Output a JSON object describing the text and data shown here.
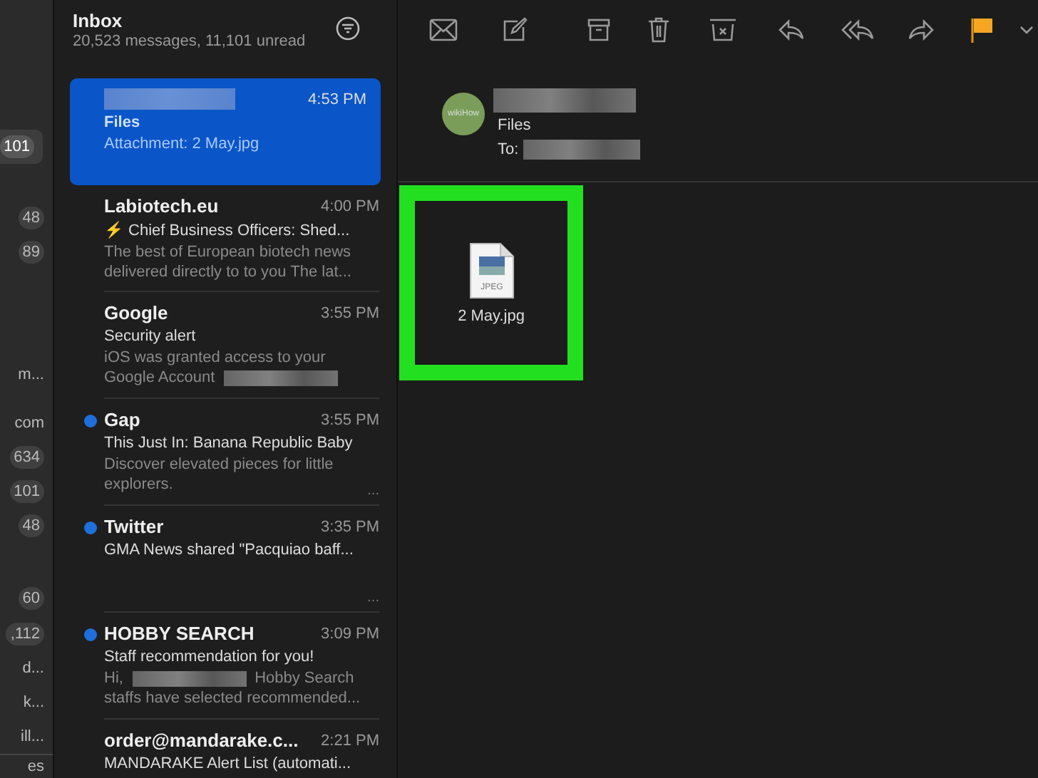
{
  "sidebar": {
    "items": [
      {
        "kind": "badge",
        "text": "101",
        "selected": true
      },
      {
        "kind": "badge",
        "text": "48",
        "selected": false
      },
      {
        "kind": "badge",
        "text": "89",
        "selected": false
      },
      {
        "kind": "label",
        "text": "m...",
        "selected": false
      },
      {
        "kind": "label",
        "text": "com",
        "selected": false
      },
      {
        "kind": "badge",
        "text": "634",
        "selected": false
      },
      {
        "kind": "badge",
        "text": "101",
        "selected": false
      },
      {
        "kind": "badge",
        "text": "48",
        "selected": false
      },
      {
        "kind": "badge",
        "text": "60",
        "selected": false
      },
      {
        "kind": "badge",
        "text": ",112",
        "selected": false
      },
      {
        "kind": "label",
        "text": "d...",
        "selected": false
      },
      {
        "kind": "label",
        "text": "k...",
        "selected": false
      },
      {
        "kind": "label",
        "text": "ill...",
        "selected": false
      },
      {
        "kind": "footer",
        "text": "es",
        "selected": false
      }
    ]
  },
  "mailbox": {
    "title": "Inbox",
    "subtitle": "20,523 messages, 11,101 unread"
  },
  "messages": [
    {
      "time": "4:53 PM",
      "subject": "Files",
      "preview": [
        {
          "kind": "text",
          "text": "Attachment: 2 May.jpg"
        }
      ],
      "selected": true,
      "unread": false
    },
    {
      "sender": "Labiotech.eu",
      "time": "4:00 PM",
      "subject": "⚡ Chief Business Officers: Shed...",
      "preview": [
        {
          "kind": "text",
          "text": "The best of European biotech news delivered directly to to you The lat..."
        }
      ],
      "selected": false,
      "unread": false
    },
    {
      "sender": "Google",
      "time": "3:55 PM",
      "subject": "Security alert",
      "preview": [
        {
          "kind": "text",
          "text": "iOS was granted access to your"
        },
        {
          "kind": "text",
          "text": "Google Account"
        },
        {
          "kind": "redacted"
        }
      ],
      "selected": false,
      "unread": false
    },
    {
      "sender": "Gap",
      "time": "3:55 PM",
      "subject": "This Just In: Banana Republic Baby",
      "preview": [
        {
          "kind": "text",
          "text": "Discover elevated pieces for little explorers."
        }
      ],
      "more": "...",
      "selected": false,
      "unread": true
    },
    {
      "sender": "Twitter",
      "time": "3:35 PM",
      "subject": "GMA News shared \"Pacquiao baff...",
      "more": "...",
      "selected": false,
      "unread": true
    },
    {
      "sender": "HOBBY SEARCH",
      "time": "3:09 PM",
      "subject": "Staff recommendation for you!",
      "preview": [
        {
          "kind": "text",
          "text": "Hi,"
        },
        {
          "kind": "redacted"
        },
        {
          "kind": "text",
          "text": "Hobby Search"
        },
        {
          "kind": "text",
          "text": "staffs have selected recommended..."
        }
      ],
      "selected": false,
      "unread": true
    },
    {
      "sender": "order@mandarake.c...",
      "time": "2:21 PM",
      "subject": "MANDARAKE Alert List (automati...",
      "selected": false,
      "unread": false
    }
  ],
  "reader": {
    "avatar_text": "wikiHow",
    "subject": "Files",
    "to_label": "To:",
    "attachment": {
      "file_type": "JPEG",
      "name": "2 May.jpg",
      "highlighted": true
    }
  }
}
